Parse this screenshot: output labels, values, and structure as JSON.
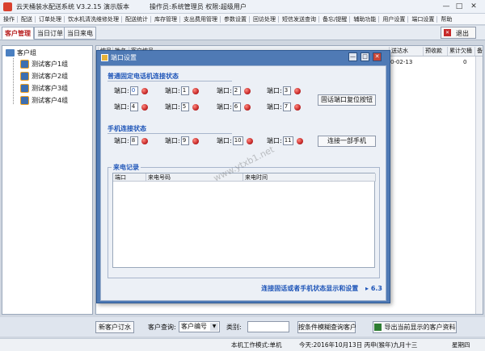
{
  "titlebar": {
    "app_title": "云天桶装水配送系统 V3.2.15 演示版本",
    "user_info": "操作员:系统管理员  权限:超级用户",
    "minimize": "—",
    "maximize": "□",
    "close": "✕"
  },
  "menu": [
    "操作",
    "配送",
    "订单处理",
    "饮水机清洗维修处理",
    "配送统计",
    "库存管理",
    "支出费用管理",
    "参数设置",
    "回访处理",
    "短信发送查询",
    "备忘/提醒",
    "辅助功能",
    "用户设置",
    "端口设置",
    "帮助"
  ],
  "tabs": [
    "客户管理",
    "当日订单",
    "当日来电"
  ],
  "exit_label": "退出",
  "tree": {
    "root": "客户组",
    "nodes": [
      "测试客户1组",
      "测试客户2组",
      "测试客户3组",
      "测试客户4组"
    ]
  },
  "grid": {
    "columns": [
      "编号",
      "姓名",
      "客户编号",
      "",
      "",
      "",
      "",
      "",
      "",
      "",
      "",
      "",
      "",
      "",
      "",
      "送达水",
      "预收款",
      "累计欠桶",
      "备"
    ],
    "date_value": "0-02-13",
    "debt_value": "0"
  },
  "dialog": {
    "title": "端口设置",
    "fixed_section_title": "普通固定电话机连接状态",
    "port_label": "端口:",
    "fixed_ports": [
      "0",
      "1",
      "2",
      "3",
      "4",
      "5",
      "6",
      "7"
    ],
    "fixed_reset_button": "固话端口复位按钮",
    "mobile_section_title": "手机连接状态",
    "mobile_ports": [
      "8",
      "9",
      "10",
      "11"
    ],
    "connect_mobile_button": "连接一部手机",
    "log_title": "来电记录",
    "log_columns": [
      "端口",
      "来电号码",
      "来电时间"
    ],
    "footer_text": "连接固话或者手机状态显示和设置",
    "footer_version": "6.3"
  },
  "bottom": {
    "new_order_button": "新客户订水",
    "query_label": "客户查询:",
    "query_select_value": "客户编号",
    "category_label": "类别:",
    "category_value": "",
    "fuzzy_query_button": "按条件模糊查询客户",
    "export_button": "导出当前显示的客户资料"
  },
  "status": {
    "mode": "本机工作模式:单机",
    "today": "今天:2016年10月13日 丙申(猴年)九月十三",
    "weekday": "星期四"
  },
  "watermark": "www.ytxb1.net"
}
